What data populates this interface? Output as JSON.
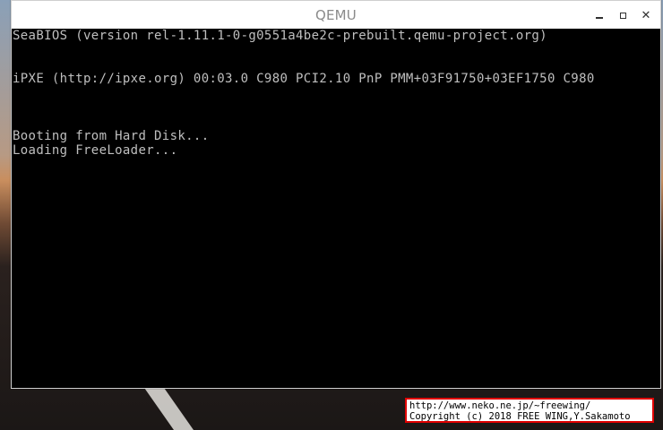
{
  "window": {
    "title": "QEMU",
    "controls": {
      "minimize": "minimize",
      "maximize": "maximize",
      "close": "close"
    }
  },
  "console": {
    "lines": [
      "SeaBIOS (version rel-1.11.1-0-g0551a4be2c-prebuilt.qemu-project.org)",
      "iPXE (http://ipxe.org) 00:03.0 C980 PCI2.10 PnP PMM+03F91750+03EF1750 C980",
      "Booting from Hard Disk...",
      "Loading FreeLoader..."
    ]
  },
  "watermark": {
    "url": "http://www.neko.ne.jp/~freewing/",
    "copyright": "Copyright (c) 2018 FREE WING,Y.Sakamoto"
  },
  "colors": {
    "console_bg": "#000000",
    "console_text": "#bfbfbf",
    "watermark_border": "#e00000",
    "titlebar_text": "#8a8a8a"
  }
}
